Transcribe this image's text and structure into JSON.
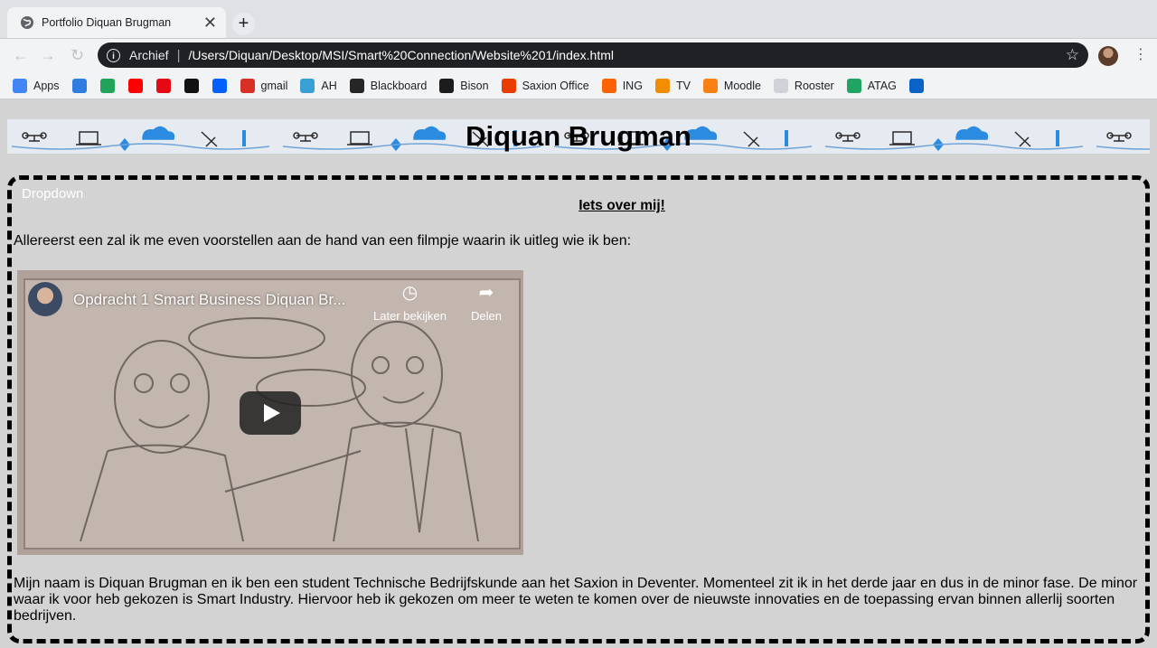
{
  "browser": {
    "tab_title": "Portfolio Diquan Brugman",
    "tab_close": "✕",
    "new_tab": "+",
    "address_chip": "Archief",
    "address_separator": "|",
    "url": "/Users/Diquan/Desktop/MSI/Smart%20Connection/Website%201/index.html",
    "star": "☆",
    "menu": "⋮",
    "info_glyph": "i",
    "nav": {
      "back": "←",
      "forward": "→",
      "reload": "↻"
    }
  },
  "bookmarks": [
    {
      "label": "Apps",
      "icon": "apps-grid-icon",
      "color": "#4285f4"
    },
    {
      "label": "",
      "icon": "diamond-icon",
      "color": "#2f7de1"
    },
    {
      "label": "",
      "icon": "xbox-icon",
      "color": "#21a35b"
    },
    {
      "label": "",
      "icon": "youtube-icon",
      "color": "#ff0000"
    },
    {
      "label": "",
      "icon": "netflix-icon",
      "color": "#e50914"
    },
    {
      "label": "",
      "icon": "v-icon",
      "color": "#111111"
    },
    {
      "label": "",
      "icon": "dropbox-icon",
      "color": "#0061fe"
    },
    {
      "label": "gmail",
      "icon": "gmail-icon",
      "color": "#d93025"
    },
    {
      "label": "AH",
      "icon": "ah-icon",
      "color": "#39a0d6"
    },
    {
      "label": "Blackboard",
      "icon": "blackboard-icon",
      "color": "#262626"
    },
    {
      "label": "Bison",
      "icon": "bison-icon",
      "color": "#1c1c1c"
    },
    {
      "label": "Saxion Office",
      "icon": "office-icon",
      "color": "#eb3c00"
    },
    {
      "label": "ING",
      "icon": "ing-icon",
      "color": "#ff6200"
    },
    {
      "label": "TV",
      "icon": "tv-icon",
      "color": "#f28c00"
    },
    {
      "label": "Moodle",
      "icon": "moodle-icon",
      "color": "#f98012"
    },
    {
      "label": "Rooster",
      "icon": "rooster-icon",
      "color": "#cfd2d6"
    },
    {
      "label": "ATAG",
      "icon": "drive-icon",
      "color": "#1fa463"
    },
    {
      "label": "",
      "icon": "outlook-icon",
      "color": "#0a64c8"
    }
  ],
  "page": {
    "banner_title": "Diquan Brugman",
    "dropdown_label": "Dropdown",
    "section_heading": "Iets over mij!",
    "intro_text": "Allereerst een zal ik me even voorstellen aan de hand van een filmpje waarin ik uitleg wie ik ben:",
    "video": {
      "title": "Opdracht 1 Smart Business Diquan Br...",
      "watch_later": "Later bekijken",
      "share": "Delen",
      "watch_later_icon": "◷",
      "share_icon": "➦"
    },
    "bio_text": "Mijn naam is Diquan Brugman en ik ben een student Technische Bedrijfskunde aan het Saxion in Deventer. Momenteel zit ik in het derde jaar en dus in de minor fase. De minor waar ik voor heb gekozen is Smart Industry. Hiervoor heb ik gekozen om meer te weten te komen over de nieuwste innovaties en de toepassing ervan binnen allerlij soorten bedrijven."
  }
}
